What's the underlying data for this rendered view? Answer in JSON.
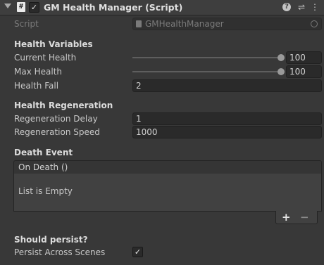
{
  "header": {
    "script_glyph": "#",
    "enabled_check": "✓",
    "title": "GM Health Manager (Script)",
    "help_glyph": "?",
    "presets_glyph": "⇌",
    "menu_glyph": "⋮"
  },
  "script_field": {
    "label": "Script",
    "value": "GMHealthManager"
  },
  "sections": {
    "health_variables": "Health Variables",
    "health_regeneration": "Health Regeneration",
    "death_event": "Death Event",
    "should_persist": "Should persist?"
  },
  "fields": {
    "current_health": {
      "label": "Current Health",
      "value": "100",
      "slider_fraction": 1.0
    },
    "max_health": {
      "label": "Max Health",
      "value": "100",
      "slider_fraction": 1.0
    },
    "health_fall": {
      "label": "Health Fall",
      "value": "2"
    },
    "regeneration_delay": {
      "label": "Regeneration Delay",
      "value": "1"
    },
    "regeneration_speed": {
      "label": "Regeneration Speed",
      "value": "1000"
    },
    "persist_across_scenes": {
      "label": "Persist Across Scenes",
      "checked": true,
      "check_glyph": "✓"
    }
  },
  "death_event_list": {
    "header": "On Death ()",
    "empty_text": "List is Empty",
    "add_label": "+",
    "remove_label": "−"
  }
}
